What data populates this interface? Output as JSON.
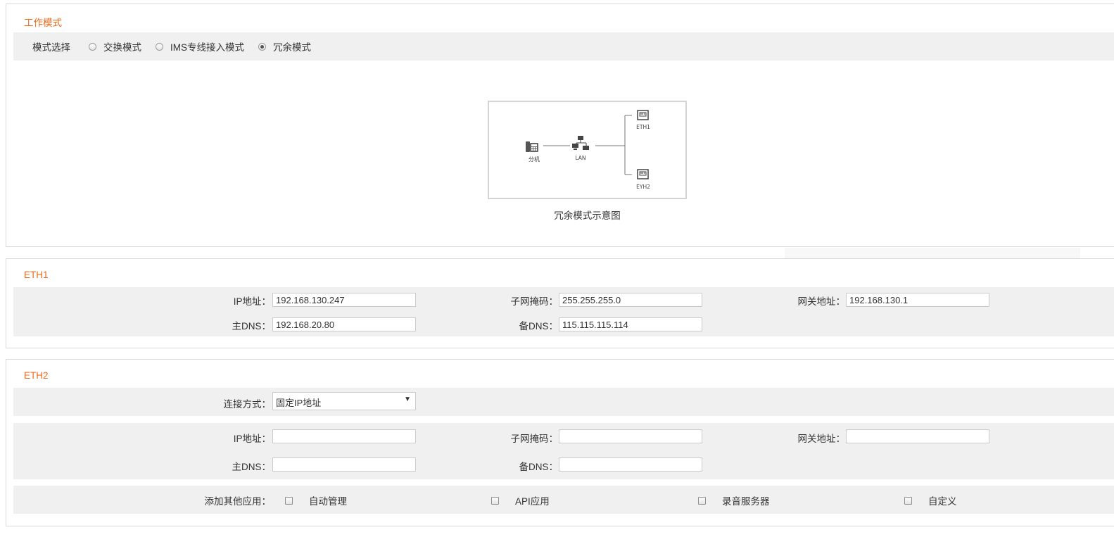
{
  "work_mode": {
    "title": "工作模式",
    "mode_label": "模式选择",
    "options": [
      "交换模式",
      "IMS专线接入模式",
      "冗余模式"
    ],
    "selected": "冗余模式",
    "diagram": {
      "extension_label": "分机",
      "lan_label": "LAN",
      "eth1_label": "ETH1",
      "eth2_label": "EYH2",
      "caption": "冗余模式示意图"
    }
  },
  "eth1": {
    "title": "ETH1",
    "ip_label": "IP地址：",
    "ip_value": "192.168.130.247",
    "mask_label": "子网掩码：",
    "mask_value": "255.255.255.0",
    "gateway_label": "网关地址：",
    "gateway_value": "192.168.130.1",
    "dns1_label": "主DNS：",
    "dns1_value": "192.168.20.80",
    "dns2_label": "备DNS：",
    "dns2_value": "115.115.115.114"
  },
  "eth2": {
    "title": "ETH2",
    "connect_label": "连接方式：",
    "connect_value": "固定IP地址",
    "ip_label": "IP地址：",
    "ip_value": "",
    "mask_label": "子网掩码：",
    "mask_value": "",
    "gateway_label": "网关地址：",
    "gateway_value": "",
    "dns1_label": "主DNS：",
    "dns1_value": "",
    "dns2_label": "备DNS：",
    "dns2_value": "",
    "apps_label": "添加其他应用：",
    "apps": [
      "自动管理",
      "API应用",
      "录音服务器",
      "自定义"
    ]
  },
  "colors": {
    "accent": "#f26b1d",
    "band": "#f0f0f0",
    "border": "#d9d9d9"
  }
}
